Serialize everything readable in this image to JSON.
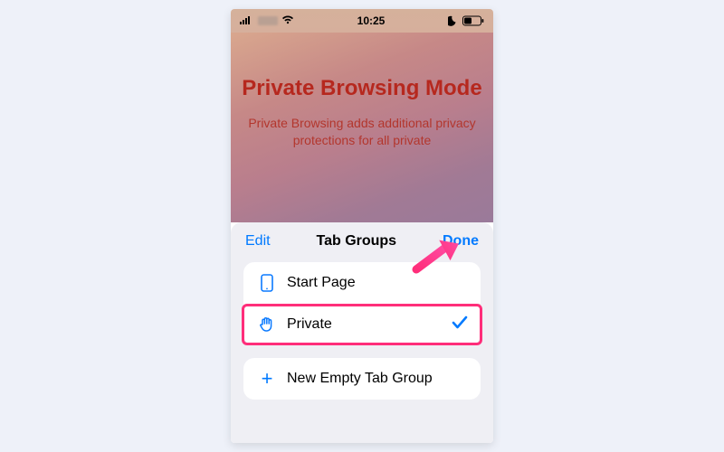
{
  "statusbar": {
    "time": "10:25"
  },
  "hero": {
    "title": "Private Browsing Mode",
    "subtitle": "Private Browsing adds additional privacy protections for all private"
  },
  "sheet": {
    "edit": "Edit",
    "title": "Tab Groups",
    "done": "Done",
    "rows": {
      "startpage": "Start Page",
      "private": "Private",
      "newgroup": "New Empty Tab Group"
    }
  }
}
